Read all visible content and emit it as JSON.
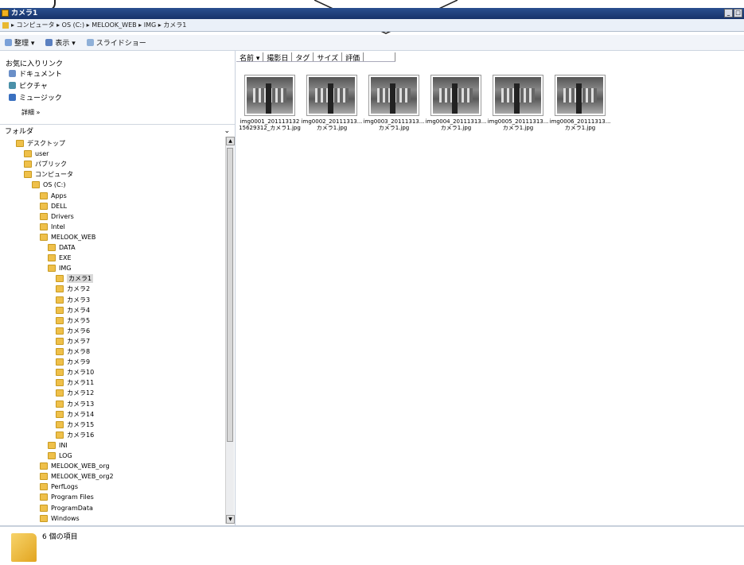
{
  "window": {
    "title": "カメラ1"
  },
  "address": {
    "path": "▸ コンピュータ ▸ OS (C:) ▸ MELOOK_WEB ▸ IMG ▸ カメラ1"
  },
  "toolbar": {
    "organize": "整理 ▾",
    "view": "表示 ▾",
    "slideshow": "スライドショー"
  },
  "favorites": {
    "title": "お気に入りリンク",
    "items": [
      "ドキュメント",
      "ピクチャ",
      "ミュージック"
    ],
    "details": "詳細 »"
  },
  "folders": {
    "title": "フォルダ",
    "tree": [
      {
        "label": "デスクトップ",
        "level": 1
      },
      {
        "label": "user",
        "level": 2
      },
      {
        "label": "パブリック",
        "level": 2
      },
      {
        "label": "コンピュータ",
        "level": 2
      },
      {
        "label": "OS (C:)",
        "level": 3
      },
      {
        "label": "Apps",
        "level": 4
      },
      {
        "label": "DELL",
        "level": 4
      },
      {
        "label": "Drivers",
        "level": 4
      },
      {
        "label": "Intel",
        "level": 4
      },
      {
        "label": "MELOOK_WEB",
        "level": 4
      },
      {
        "label": "DATA",
        "level": 5
      },
      {
        "label": "EXE",
        "level": 5
      },
      {
        "label": "IMG",
        "level": 5
      },
      {
        "label": "カメラ1",
        "level": 6,
        "selected": true
      },
      {
        "label": "カメラ2",
        "level": 6
      },
      {
        "label": "カメラ3",
        "level": 6
      },
      {
        "label": "カメラ4",
        "level": 6
      },
      {
        "label": "カメラ5",
        "level": 6
      },
      {
        "label": "カメラ6",
        "level": 6
      },
      {
        "label": "カメラ7",
        "level": 6
      },
      {
        "label": "カメラ8",
        "level": 6
      },
      {
        "label": "カメラ9",
        "level": 6
      },
      {
        "label": "カメラ10",
        "level": 6
      },
      {
        "label": "カメラ11",
        "level": 6
      },
      {
        "label": "カメラ12",
        "level": 6
      },
      {
        "label": "カメラ13",
        "level": 6
      },
      {
        "label": "カメラ14",
        "level": 6
      },
      {
        "label": "カメラ15",
        "level": 6
      },
      {
        "label": "カメラ16",
        "level": 6
      },
      {
        "label": "INI",
        "level": 5
      },
      {
        "label": "LOG",
        "level": 5
      },
      {
        "label": "MELOOK_WEB_org",
        "level": 4
      },
      {
        "label": "MELOOK_WEB_org2",
        "level": 4
      },
      {
        "label": "PerfLogs",
        "level": 4
      },
      {
        "label": "Program Files",
        "level": 4
      },
      {
        "label": "ProgramData",
        "level": 4
      },
      {
        "label": "Windows",
        "level": 4
      }
    ]
  },
  "columns": [
    "名前 ▾",
    "撮影日",
    "タグ",
    "サイズ",
    "評価"
  ],
  "files": [
    "img0001_20111313215629312_カメラ1.jpg",
    "img0002_20111313... カメラ1.jpg",
    "img0003_20111313... カメラ1.jpg",
    "img0004_20111313... カメラ1.jpg",
    "img0005_20111313... カメラ1.jpg",
    "img0006_20111313... カメラ1.jpg"
  ],
  "status": {
    "count": "6 個の項目"
  }
}
